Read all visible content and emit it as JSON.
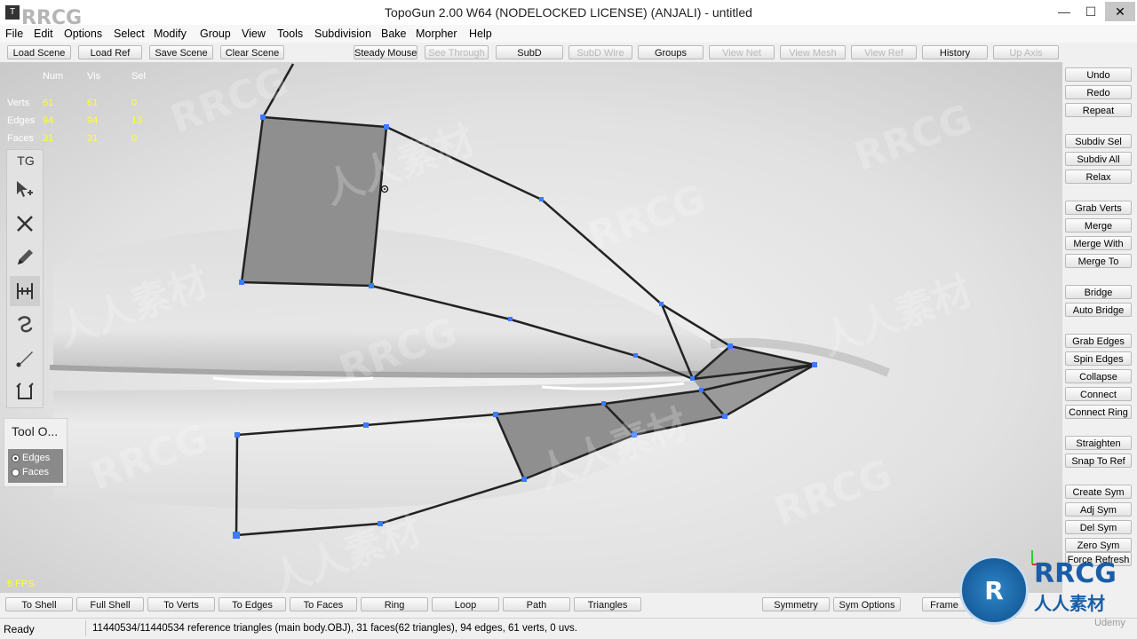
{
  "window": {
    "title": "TopoGun 2.00 W64  (NODELOCKED LICENSE) (ANJALI) - untitled",
    "icon": "topogun-app-icon",
    "minimize": "—",
    "maximize": "☐",
    "close": "✕"
  },
  "watermark": {
    "corner": "RRCG",
    "text_latin": "RRCG",
    "text_cjk": "人人素材"
  },
  "menu": [
    "File",
    "Edit",
    "Options",
    "Select",
    "Modify",
    "Group",
    "View",
    "Tools",
    "Subdivision",
    "Bake",
    "Morpher",
    "Help"
  ],
  "toolbar": [
    {
      "label": "Load Scene",
      "enabled": true
    },
    {
      "label": "Load Ref",
      "enabled": true
    },
    {
      "label": "Save Scene",
      "enabled": true
    },
    {
      "label": "Clear Scene",
      "enabled": true
    },
    {
      "label": "Steady Mouse",
      "enabled": true
    },
    {
      "label": "See Through",
      "enabled": false
    },
    {
      "label": "SubD",
      "enabled": true
    },
    {
      "label": "SubD Wire",
      "enabled": false
    },
    {
      "label": "Groups",
      "enabled": true
    },
    {
      "label": "View Net",
      "enabled": false
    },
    {
      "label": "View Mesh",
      "enabled": false
    },
    {
      "label": "View Ref",
      "enabled": false
    },
    {
      "label": "History",
      "enabled": true
    },
    {
      "label": "Up Axis",
      "enabled": false
    }
  ],
  "stats": {
    "headers": [
      "Num",
      "Vis",
      "Sel"
    ],
    "rows": [
      {
        "label": "Verts",
        "num": "61",
        "vis": "61",
        "sel": "0"
      },
      {
        "label": "Edges",
        "num": "94",
        "vis": "94",
        "sel": "13"
      },
      {
        "label": "Faces",
        "num": "31",
        "vis": "31",
        "sel": "0"
      }
    ]
  },
  "tg_panel": {
    "title": "TG",
    "tools": [
      "create-tool-icon",
      "delete-tool-icon",
      "draw-tool-icon",
      "bridge-tool-icon",
      "brush-tool-icon",
      "paint-tool-icon",
      "tubes-tool-icon"
    ],
    "active_index": 3
  },
  "tool_options": {
    "title": "Tool O...",
    "options": [
      {
        "label": "Edges",
        "checked": true
      },
      {
        "label": "Faces",
        "checked": false
      }
    ]
  },
  "fps": "6 FPS",
  "right_panel": [
    "Undo",
    "Redo",
    "Repeat",
    "Subdiv Sel",
    "Subdiv All",
    "Relax",
    "Grab Verts",
    "Merge",
    "Merge With",
    "Merge To",
    "Bridge",
    "Auto Bridge",
    "Grab Edges",
    "Spin Edges",
    "Collapse",
    "Connect",
    "Connect Ring",
    "Straighten",
    "Snap To Ref",
    "Create Sym",
    "Adj Sym",
    "Del Sym",
    "Zero Sym",
    "Force Refresh"
  ],
  "bottom_bar": [
    "To Shell",
    "Full Shell",
    "To Verts",
    "To Edges",
    "To Faces",
    "Ring",
    "Loop",
    "Path",
    "Triangles",
    "Symmetry",
    "Sym Options",
    "Frame"
  ],
  "status": {
    "left": "Ready",
    "main": "11440534/11440534 reference triangles (main body.OBJ), 31 faces(62 triangles), 94 edges, 61 verts, 0 uvs."
  },
  "logo": {
    "badge": "R",
    "text": "RRCG",
    "sub": "人人素材",
    "udemy": "Udemy"
  }
}
